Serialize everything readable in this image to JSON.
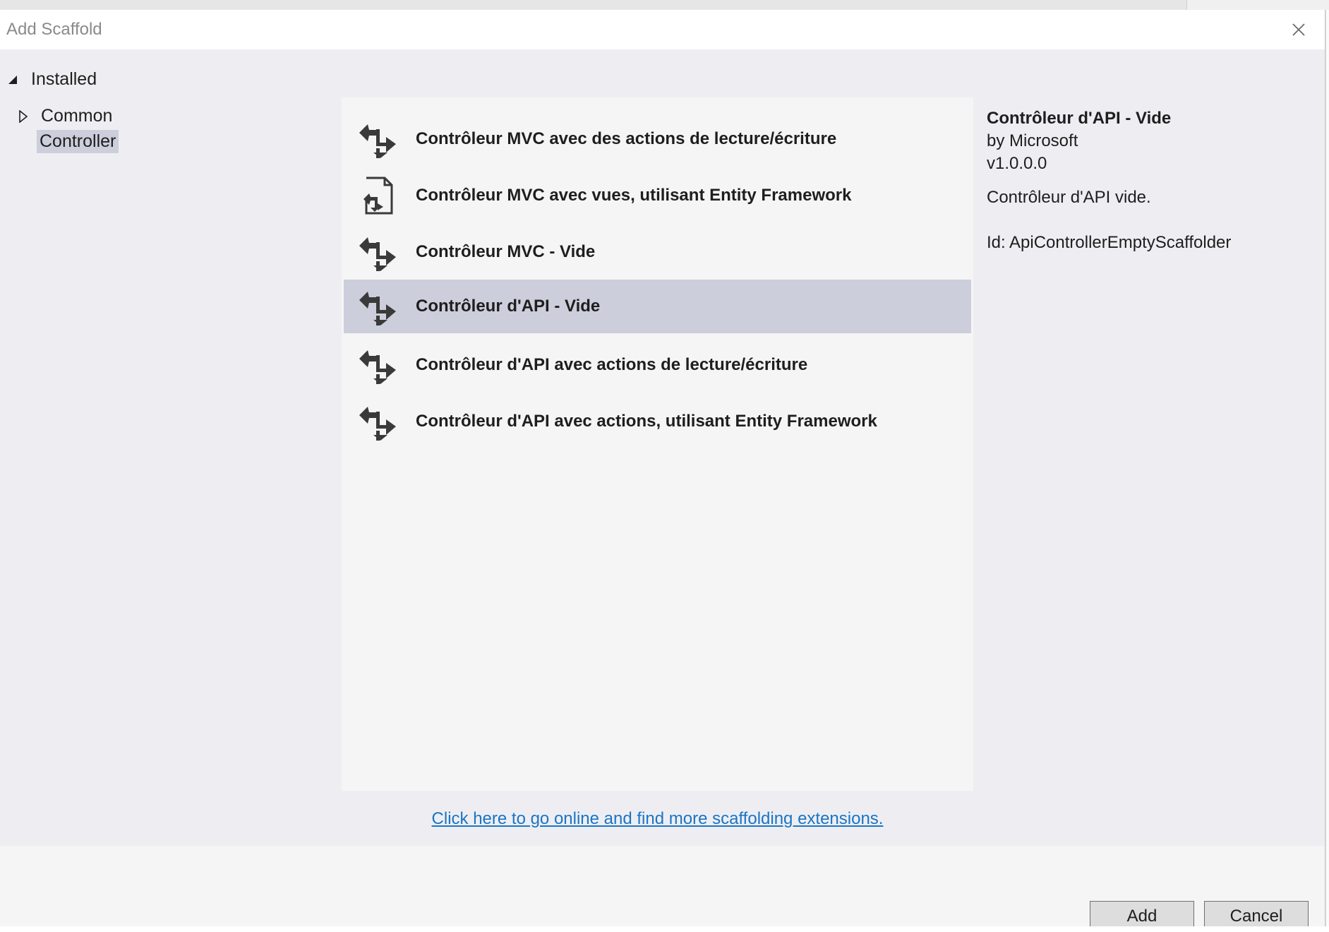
{
  "dialog": {
    "title": "Add Scaffold"
  },
  "tree": {
    "root_label": "Installed",
    "items": [
      {
        "label": "Common",
        "expandable": true,
        "selected": false
      },
      {
        "label": "Controller",
        "expandable": false,
        "selected": true
      }
    ]
  },
  "list": {
    "items": [
      {
        "label": "Contrôleur MVC avec des actions de lecture/écriture",
        "icon": "controller-icon"
      },
      {
        "label": "Contrôleur MVC avec vues, utilisant Entity Framework",
        "icon": "controller-views-icon"
      },
      {
        "label": "Contrôleur MVC - Vide",
        "icon": "controller-icon"
      },
      {
        "label": "Contrôleur d'API - Vide",
        "icon": "controller-icon"
      },
      {
        "label": "Contrôleur d'API avec actions de lecture/écriture",
        "icon": "controller-icon"
      },
      {
        "label": "Contrôleur d'API avec actions, utilisant Entity Framework",
        "icon": "controller-icon"
      }
    ],
    "selected_index": 3
  },
  "details": {
    "title": "Contrôleur d'API - Vide",
    "author": "by Microsoft",
    "version": "v1.0.0.0",
    "description": "Contrôleur d'API vide.",
    "id": "Id: ApiControllerEmptyScaffolder"
  },
  "online_link": "Click here to go online and find more scaffolding extensions.",
  "buttons": {
    "add": "Add",
    "cancel": "Cancel"
  },
  "colors": {
    "selection": "#cccedb",
    "link": "#1a75c6",
    "dialog_bg": "#eeeef2",
    "list_bg": "#f5f5f5"
  }
}
